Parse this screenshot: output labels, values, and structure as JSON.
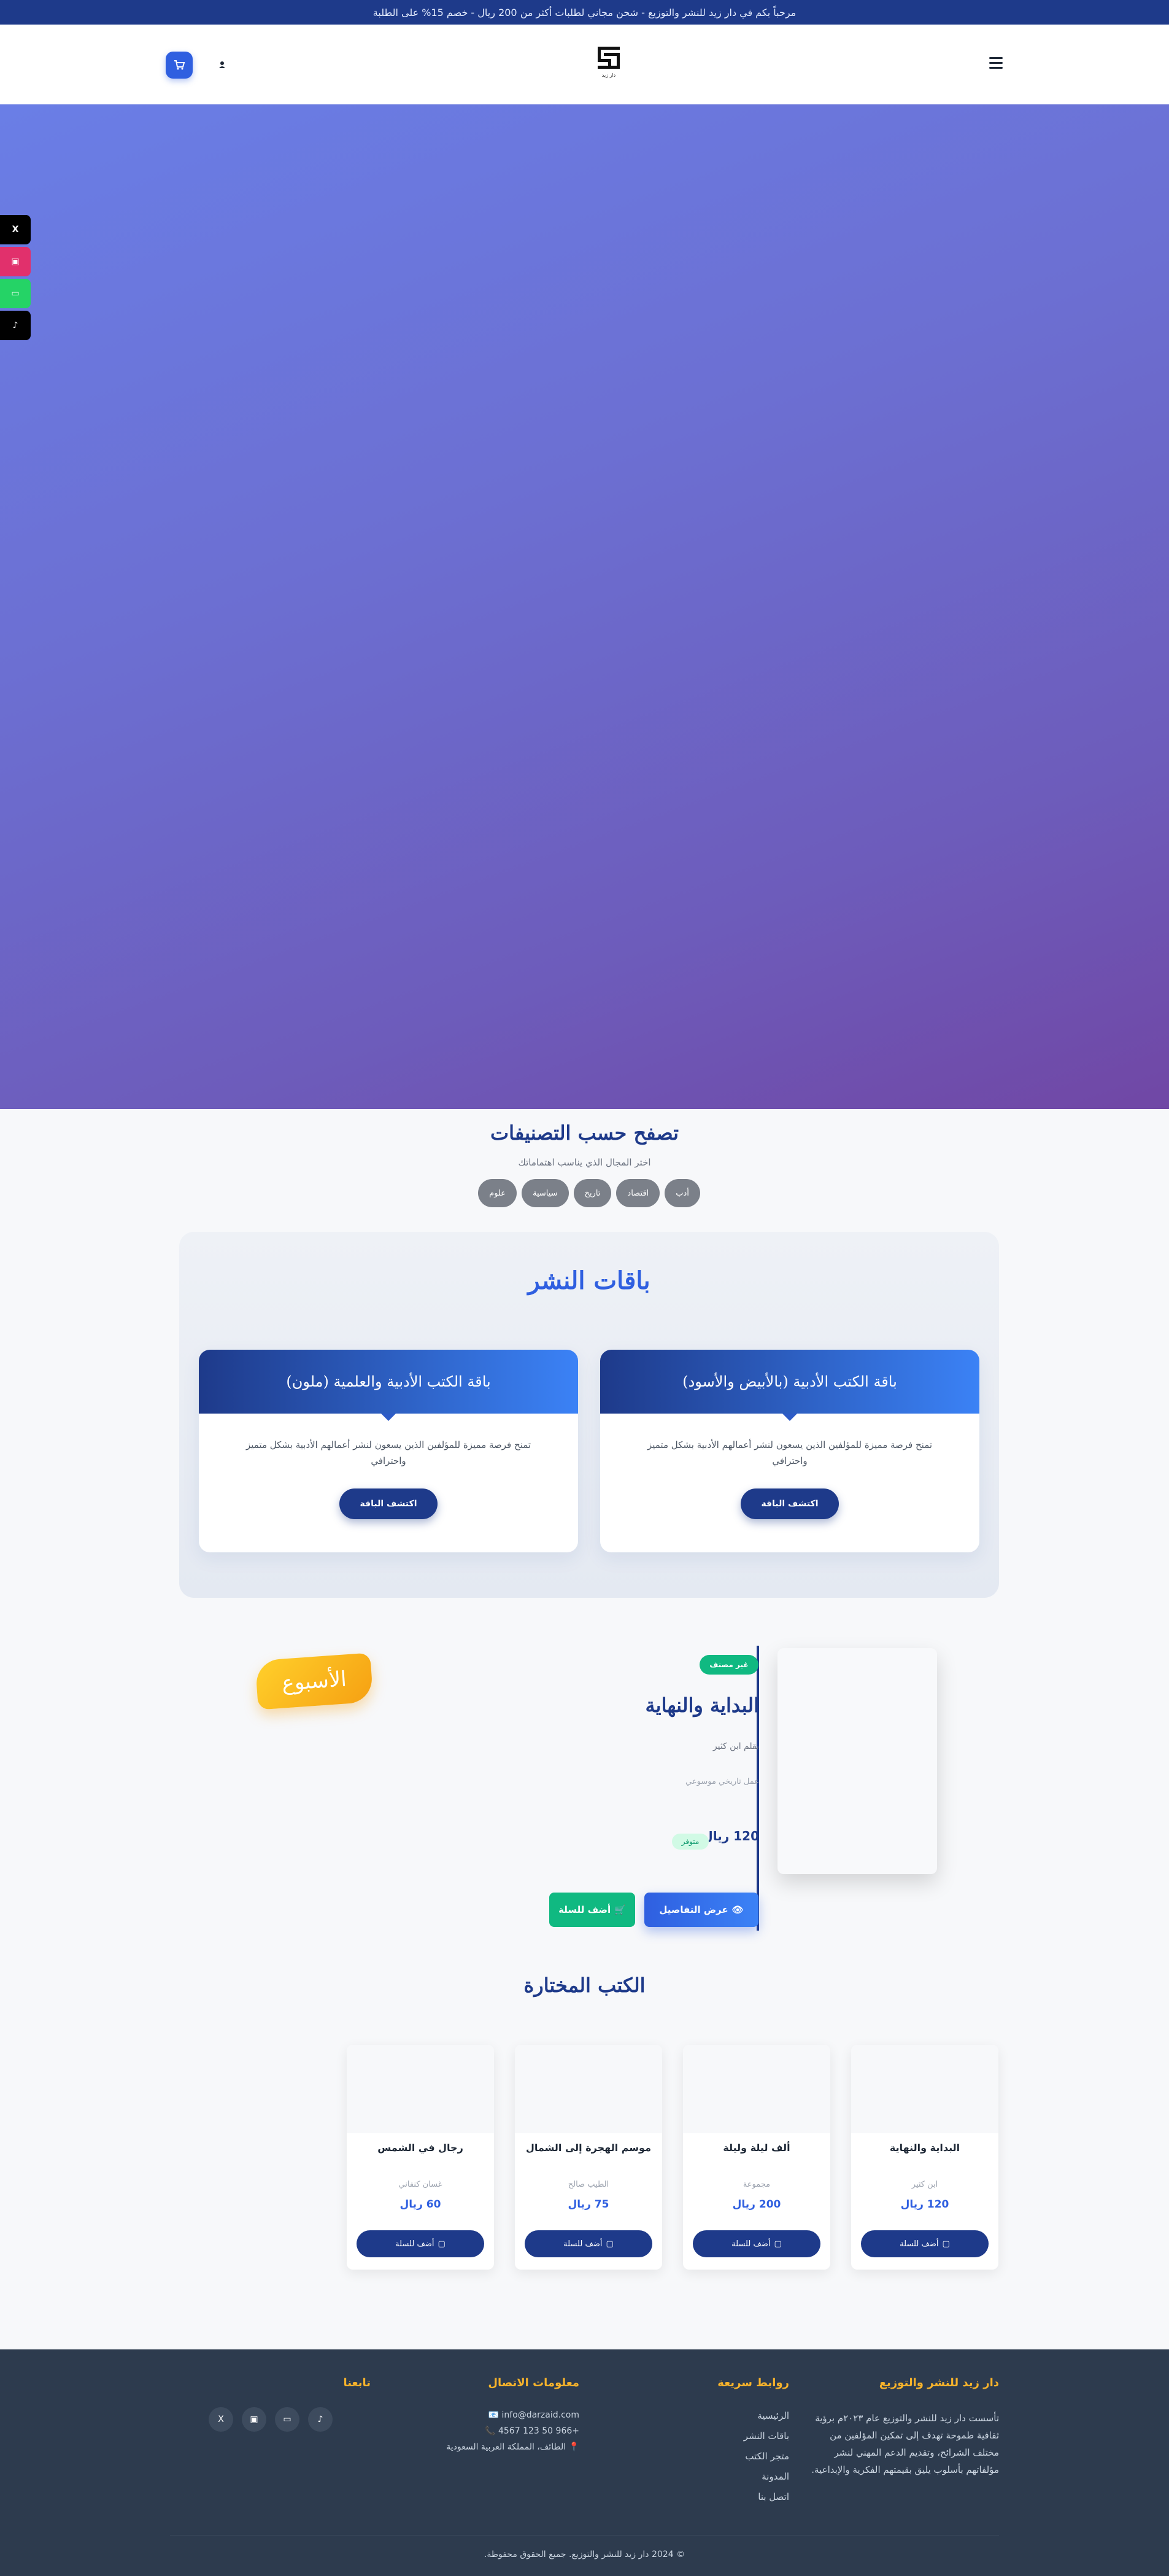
{
  "topbar": {
    "text": "مرحباً بكم في دار زيد للنشر والتوزيع - شحن مجاني لطلبات أكثر من 200 ريال - خصم 15% على الطلبة"
  },
  "header": {
    "logo_caption": "دار زيد",
    "menu_icon": "hamburger-icon",
    "user_icon": "user-icon",
    "cart_icon": "cart-icon"
  },
  "social_float": [
    {
      "label": "X",
      "color": "#000000"
    },
    {
      "label": "▣",
      "color": "#e1306c"
    },
    {
      "label": "▭",
      "color": "#25d366"
    },
    {
      "label": "♪",
      "color": "#010101"
    }
  ],
  "categories": {
    "title": "تصفح حسب التصنيفات",
    "subtitle": "اختر المجال الذي يناسب اهتماماتك",
    "tags": [
      "أدب",
      "اقتصاد",
      "تاريخ",
      "سياسية",
      "علوم"
    ]
  },
  "packages": {
    "title": "باقات النشر",
    "cards": [
      {
        "title": "باقة الكتب الأدبية (بالأبيض والأسود)",
        "description": "تمنح فرصة مميزة للمؤلفين الذين يسعون لنشر أعمالهم الأدبية بشكل متميز واحترافي",
        "button": "اكتشف الباقة"
      },
      {
        "title": "باقة الكتب الأدبية والعلمية (ملون)",
        "description": "تمنح فرصة مميزة للمؤلفين الذين يسعون لنشر أعمالهم الأدبية بشكل متميز واحترافي",
        "button": "اكتشف الباقة"
      }
    ]
  },
  "book_of_week": {
    "badge": "الأسبوع",
    "label": "غير مصنف",
    "title": "البداية والنهاية",
    "author": "بقلم ابن كثير",
    "type": "عمل تاريخي موسوعي",
    "price": "120 ريال",
    "stock": "متوفر",
    "details_button": "عرض التفاصيل",
    "cart_button": "أضف للسلة"
  },
  "featured": {
    "title": "الكتب المختارة",
    "books": [
      {
        "title": "البداية والنهاية",
        "author": "ابن كثير",
        "price": "120 ريال",
        "button": "أضف للسلة"
      },
      {
        "title": "ألف ليلة وليلة",
        "author": "مجموعة",
        "price": "200 ريال",
        "button": "أضف للسلة"
      },
      {
        "title": "موسم الهجرة إلى الشمال",
        "author": "الطيب صالح",
        "price": "75 ريال",
        "button": "أضف للسلة"
      },
      {
        "title": "رجال في الشمس",
        "author": "غسان كنفاني",
        "price": "60 ريال",
        "button": "أضف للسلة"
      }
    ]
  },
  "footer": {
    "about_title": "دار زيد للنشر والتوزيع",
    "about_text": "تأسست دار زيد للنشر والتوزيع عام ٢٠٢٣م برؤية ثقافية طموحة تهدف إلى تمكين المؤلفين من مختلف الشرائح، وتقديم الدعم المهني لنشر مؤلفاتهم بأسلوب يليق بقيمتهم الفكرية والإبداعية.",
    "links_title": "روابط سريعة",
    "links": [
      "الرئيسية",
      "باقات النشر",
      "متجر الكتب",
      "المدونة",
      "اتصل بنا"
    ],
    "contact_title": "معلومات الاتصال",
    "contact": {
      "email": "info@darzaid.com 📧",
      "phone": "+966 50 123 4567 📞",
      "address": "📍 الطائف، المملكة العربية السعودية"
    },
    "follow_title": "تابعنا",
    "social": [
      "X",
      "▣",
      "▭",
      "♪"
    ],
    "copyright": "© 2024 دار زيد للنشر والتوزيع. جميع الحقوق محفوظة."
  }
}
